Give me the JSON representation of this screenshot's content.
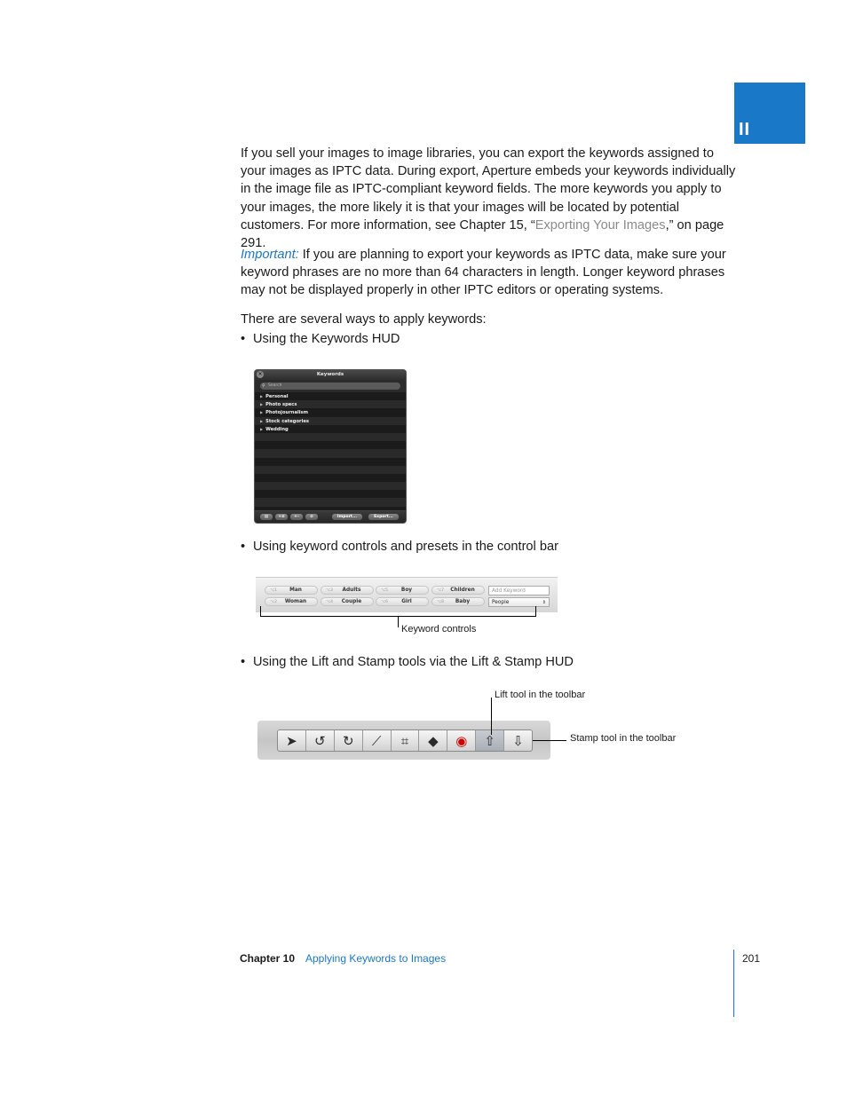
{
  "part_tab": {
    "numeral": "II",
    "color": "#1a78c8"
  },
  "paragraphs": {
    "intro_before_link": "If you sell your images to image libraries, you can export the keywords assigned to your images as IPTC data. During export, Aperture embeds your keywords individually in the image file as IPTC-compliant keyword fields. The more keywords you apply to your images, the more likely it is that your images will be located by potential customers. For more information, see Chapter 15, “",
    "intro_link": "Exporting Your Images",
    "intro_after_link": ",” on page 291.",
    "important_label": "Important:",
    "important_text": " If you are planning to export your keywords as IPTC data, make sure your keyword phrases are no more than 64 characters in length. Longer keyword phrases may not be displayed properly in other IPTC editors or operating systems.",
    "ways_intro": "There are several ways to apply keywords:"
  },
  "bullets": [
    "Using the Keywords HUD",
    "Using keyword controls and presets in the control bar",
    "Using the Lift and Stamp tools via the Lift & Stamp HUD"
  ],
  "keywords_hud": {
    "title": "Keywords",
    "search_placeholder": "Search",
    "groups": [
      "Personal",
      "Photo specs",
      "Photojournalism",
      "Stock categories",
      "Wedding"
    ],
    "import_label": "Import...",
    "export_label": "Export..."
  },
  "control_bar": {
    "buttons": [
      {
        "shortcut": "⌥1",
        "label": "Man"
      },
      {
        "shortcut": "⌥2",
        "label": "Woman"
      },
      {
        "shortcut": "⌥3",
        "label": "Adults"
      },
      {
        "shortcut": "⌥4",
        "label": "Couple"
      },
      {
        "shortcut": "⌥5",
        "label": "Boy"
      },
      {
        "shortcut": "⌥6",
        "label": "Girl"
      },
      {
        "shortcut": "⌥7",
        "label": "Children"
      },
      {
        "shortcut": "⌥8",
        "label": "Baby"
      }
    ],
    "add_keyword_placeholder": "Add Keyword",
    "preset_value": "People",
    "callout": "Keyword controls"
  },
  "toolbar": {
    "tools": [
      "select-tool",
      "rotate-left-tool",
      "rotate-right-tool",
      "straighten-tool",
      "crop-tool",
      "spot-patch-tool",
      "red-eye-tool",
      "lift-tool",
      "stamp-tool"
    ],
    "lift_callout": "Lift tool in the toolbar",
    "stamp_callout": "Stamp tool in the toolbar"
  },
  "footer": {
    "chapter": "Chapter 10",
    "chapter_title": "Applying Keywords to Images",
    "page_number": "201"
  }
}
